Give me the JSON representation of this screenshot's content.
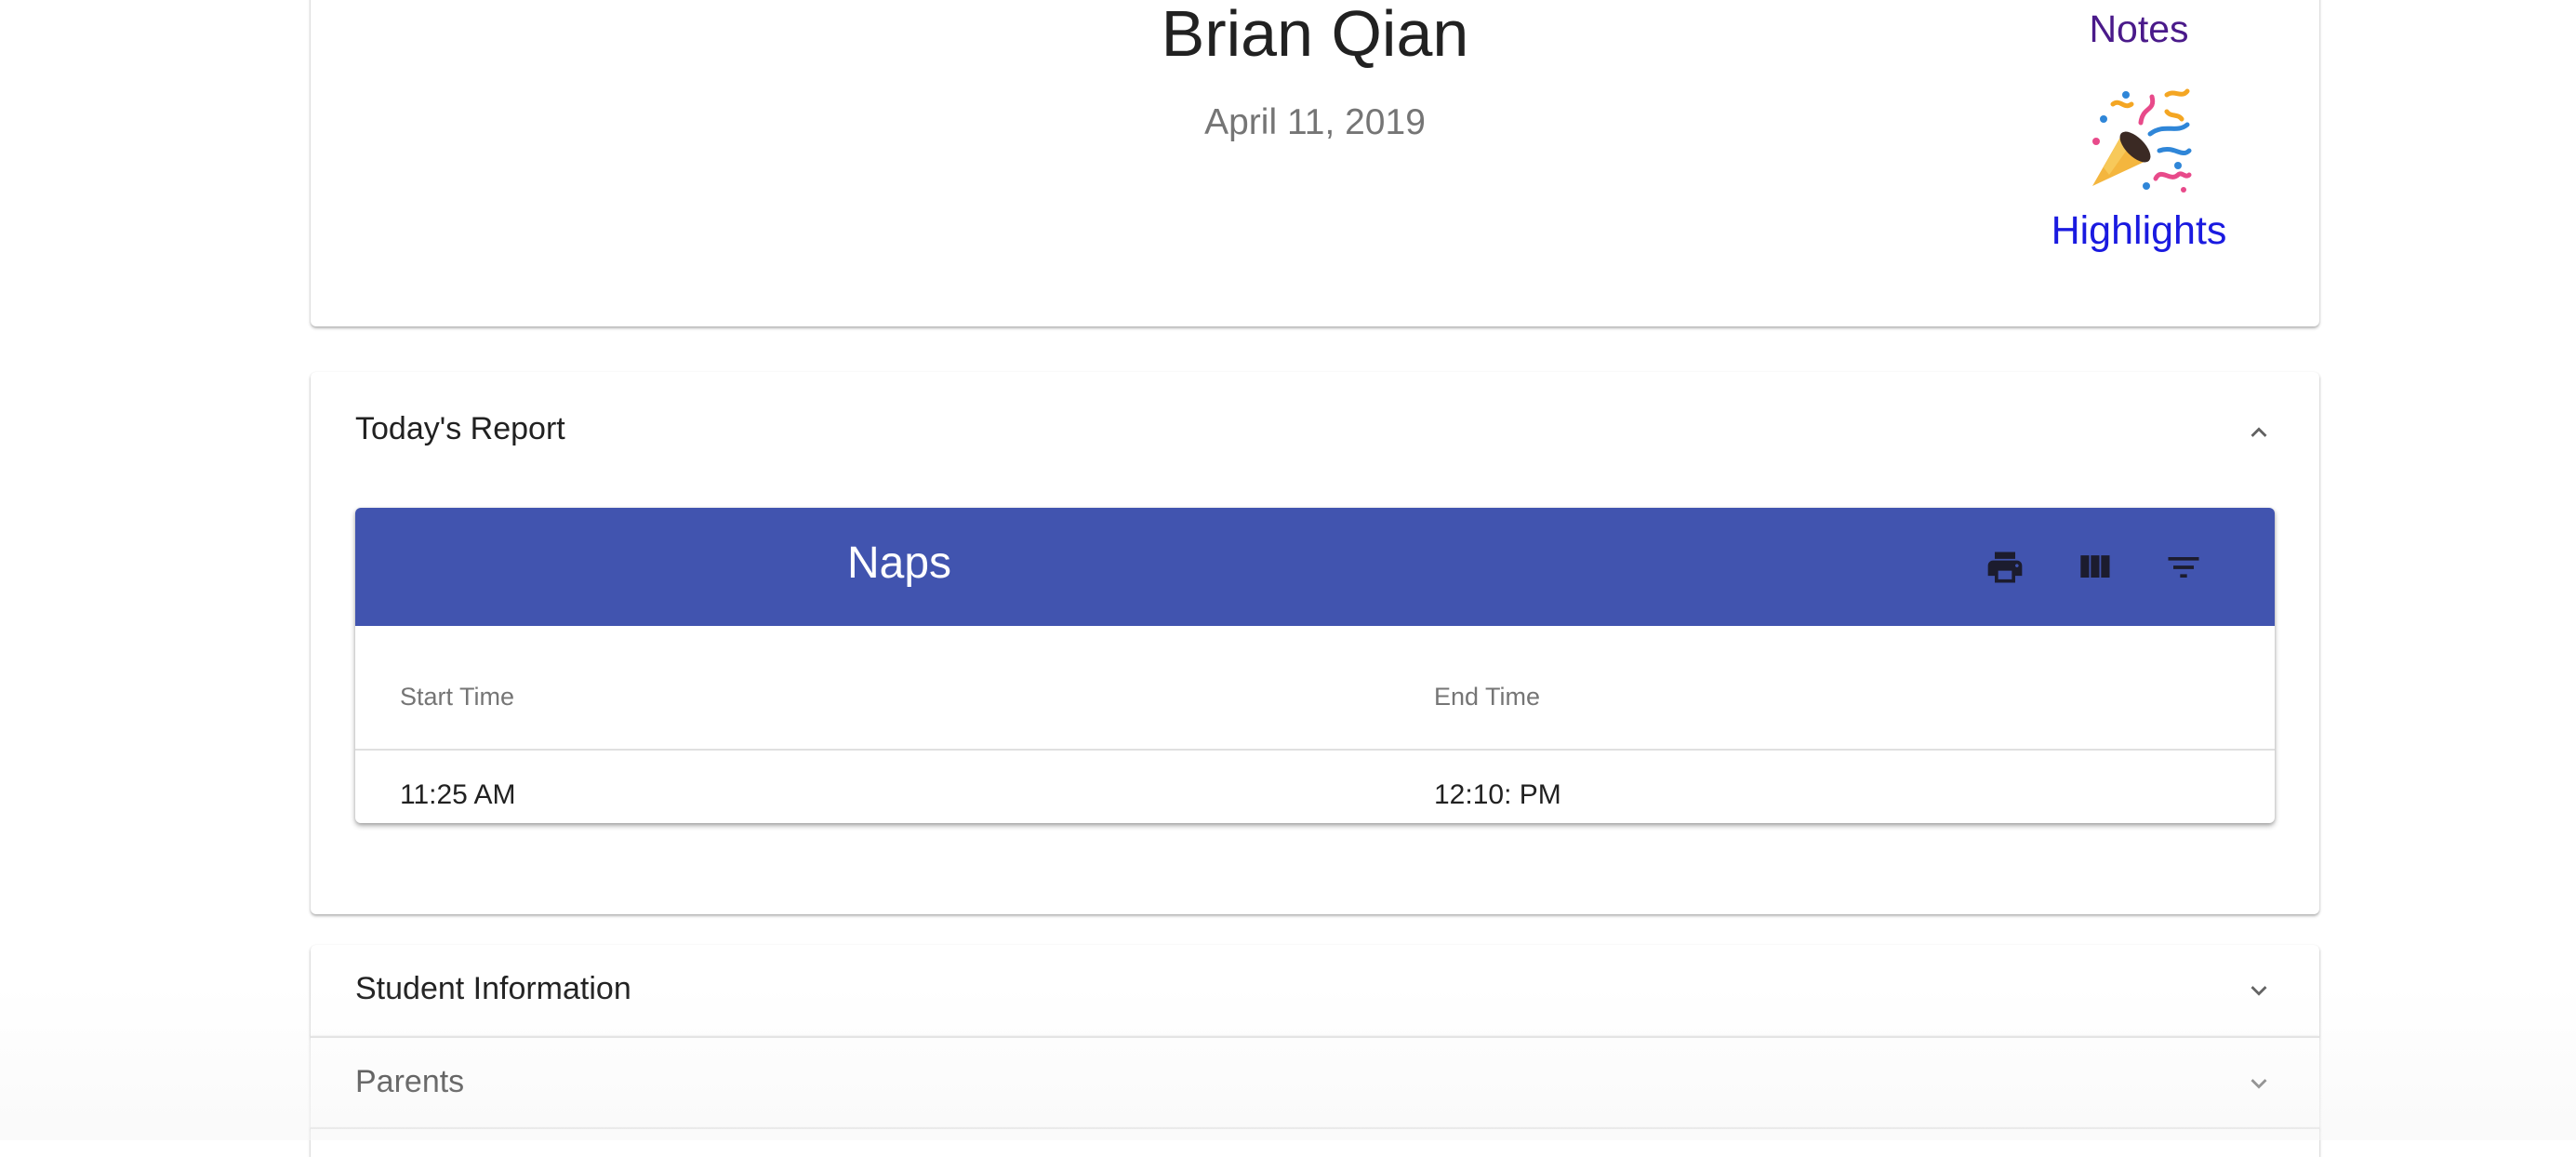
{
  "profile": {
    "name": "Brian Qian",
    "date": "April 11, 2019",
    "notes_label": "Notes",
    "highlights_label": "Highlights",
    "highlights_icon": "party-popper-icon",
    "notes_color": "#4a1a8a",
    "highlights_color": "#1a1ae0"
  },
  "report": {
    "title": "Today's Report",
    "expanded": true,
    "table": {
      "title": "Naps",
      "toolbar_color": "#4154af",
      "tools": [
        "print-icon",
        "view-columns-icon",
        "filter-icon"
      ],
      "columns": [
        "Start Time",
        "End Time"
      ],
      "rows": [
        [
          "11:25 AM",
          "12:10: PM"
        ]
      ]
    }
  },
  "panels": [
    {
      "title": "Student Information",
      "expanded": false
    },
    {
      "title": "Parents",
      "expanded": false
    }
  ]
}
